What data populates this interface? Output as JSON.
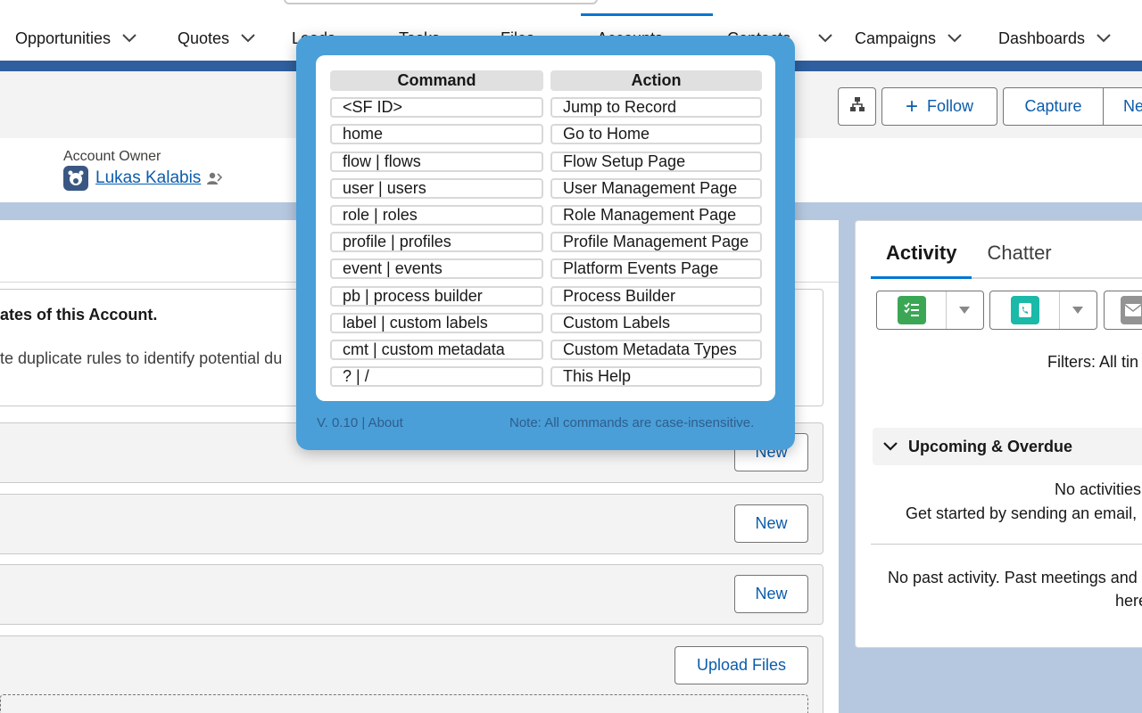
{
  "nav": {
    "items": [
      {
        "label": "Opportunities"
      },
      {
        "label": "Quotes"
      },
      {
        "label": "Leads"
      },
      {
        "label": "Tasks"
      },
      {
        "label": "Files"
      },
      {
        "label": "Accounts",
        "active": true
      },
      {
        "label": "Contacts"
      },
      {
        "label": "Campaigns"
      },
      {
        "label": "Dashboards"
      }
    ]
  },
  "header": {
    "follow_label": "Follow",
    "capture_label": "Capture",
    "new_label": "Ne",
    "owner_label": "Account Owner",
    "owner_name": "Lukas Kalabis"
  },
  "main": {
    "duplicate_title": "ates of this Account.",
    "duplicate_text": "te duplicate rules to identify potential du",
    "new_label": "New",
    "upload_label": "Upload Files"
  },
  "activity": {
    "tabs": [
      "Activity",
      "Chatter"
    ],
    "filters": "Filters: All tin",
    "upcoming_label": "Upcoming & Overdue",
    "no_activities": "No activities",
    "get_started": "Get started by sending an email,",
    "no_past": "No past activity. Past meetings and",
    "here": "here",
    "colors": {
      "task": "#3ba755",
      "call": "#0d9dda"
    }
  },
  "help": {
    "header": {
      "command": "Command",
      "action": "Action"
    },
    "rows": [
      {
        "command": "<SF ID>",
        "action": "Jump to Record"
      },
      {
        "command": "home",
        "action": "Go to Home"
      },
      {
        "command": "flow | flows",
        "action": "Flow Setup Page"
      },
      {
        "command": "user | users",
        "action": "User Management Page"
      },
      {
        "command": "role | roles",
        "action": "Role Management Page"
      },
      {
        "command": "profile | profiles",
        "action": "Profile Management Page"
      },
      {
        "command": "event | events",
        "action": "Platform Events Page"
      },
      {
        "command": "pb | process builder",
        "action": "Process Builder"
      },
      {
        "command": "label | custom labels",
        "action": "Custom Labels"
      },
      {
        "command": "cmt | custom metadata",
        "action": "Custom Metadata Types"
      },
      {
        "command": "? | /",
        "action": "This Help"
      }
    ],
    "footer_left": "V. 0.10 | About",
    "footer_right": "Note: All commands are case-insensitive."
  }
}
